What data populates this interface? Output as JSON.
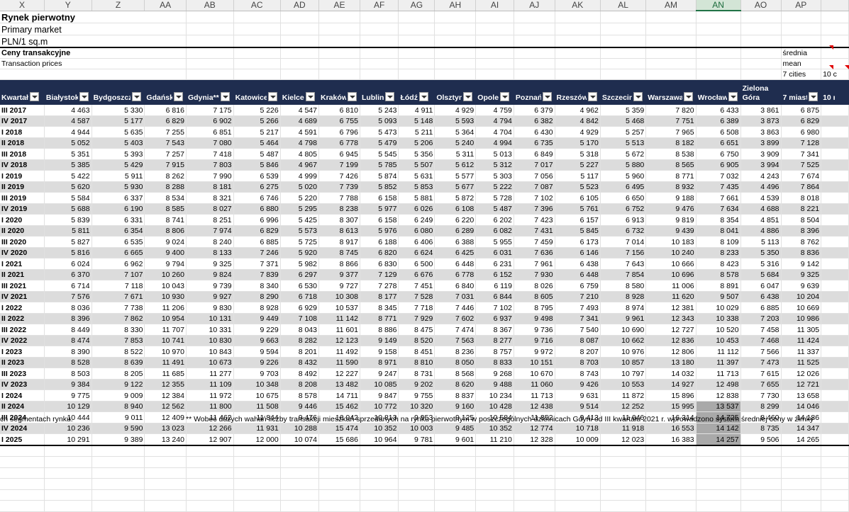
{
  "columns": [
    "X",
    "Y",
    "Z",
    "AA",
    "AB",
    "AC",
    "AD",
    "AE",
    "AF",
    "AG",
    "AH",
    "AI",
    "AJ",
    "AK",
    "AL",
    "AM",
    "AN",
    "AO",
    "AP"
  ],
  "title": {
    "line1": "Rynek pierwotny",
    "line2": "Primary market",
    "line3": "PLN/1 sq.m"
  },
  "section": {
    "line1": "Ceny transakcyjne",
    "line2": "Transaction prices"
  },
  "side": {
    "mean_pl": "średnia",
    "mean_en": "mean",
    "cities7": "7 cities",
    "cities10": "10 c"
  },
  "headers": [
    "Kwartał",
    "Białystok",
    "Bydgoszcz",
    "Gdańsk",
    "Gdynia**",
    "Katowice",
    "Kielce",
    "Kraków",
    "Lublin",
    "Łódź",
    "Olsztyn",
    "Opole",
    "Poznań",
    "Rzeszów",
    "Szczecin",
    "Warszawa",
    "Wrocław",
    "Zielona Góra",
    "7 miast",
    "10 m"
  ],
  "rows": [
    {
      "q": "III 2017",
      "v": [
        "4 463",
        "5 330",
        "6 816",
        "7 175",
        "5 226",
        "4 547",
        "6 810",
        "5 243",
        "4 911",
        "4 929",
        "4 759",
        "6 379",
        "4 962",
        "5 359",
        "7 820",
        "6 433",
        "3 861",
        "6 875"
      ]
    },
    {
      "q": "IV 2017",
      "v": [
        "4 587",
        "5 177",
        "6 829",
        "6 902",
        "5 266",
        "4 689",
        "6 755",
        "5 093",
        "5 148",
        "5 593",
        "4 794",
        "6 382",
        "4 842",
        "5 468",
        "7 751",
        "6 389",
        "3 873",
        "6 829"
      ]
    },
    {
      "q": "I 2018",
      "v": [
        "4 944",
        "5 635",
        "7 255",
        "6 851",
        "5 217",
        "4 591",
        "6 796",
        "5 473",
        "5 211",
        "5 364",
        "4 704",
        "6 430",
        "4 929",
        "5 257",
        "7 965",
        "6 508",
        "3 863",
        "6 980"
      ]
    },
    {
      "q": "II 2018",
      "v": [
        "5 052",
        "5 403",
        "7 543",
        "7 080",
        "5 464",
        "4 798",
        "6 778",
        "5 479",
        "5 206",
        "5 240",
        "4 994",
        "6 735",
        "5 170",
        "5 513",
        "8 182",
        "6 651",
        "3 899",
        "7 128"
      ]
    },
    {
      "q": "III 2018",
      "v": [
        "5 351",
        "5 393",
        "7 257",
        "7 418",
        "5 487",
        "4 805",
        "6 945",
        "5 545",
        "5 356",
        "5 311",
        "5 013",
        "6 849",
        "5 318",
        "5 672",
        "8 538",
        "6 750",
        "3 909",
        "7 341"
      ]
    },
    {
      "q": "IV 2018",
      "v": [
        "5 385",
        "5 429",
        "7 915",
        "7 803",
        "5 846",
        "4 967",
        "7 199",
        "5 785",
        "5 507",
        "5 612",
        "5 312",
        "7 017",
        "5 227",
        "5 880",
        "8 565",
        "6 905",
        "3 994",
        "7 525"
      ]
    },
    {
      "q": "I 2019",
      "v": [
        "5 422",
        "5 911",
        "8 262",
        "7 990",
        "6 539",
        "4 999",
        "7 426",
        "5 874",
        "5 631",
        "5 577",
        "5 303",
        "7 056",
        "5 117",
        "5 960",
        "8 771",
        "7 032",
        "4 243",
        "7 674"
      ]
    },
    {
      "q": "II 2019",
      "v": [
        "5 620",
        "5 930",
        "8 288",
        "8 181",
        "6 275",
        "5 020",
        "7 739",
        "5 852",
        "5 853",
        "5 677",
        "5 222",
        "7 087",
        "5 523",
        "6 495",
        "8 932",
        "7 435",
        "4 496",
        "7 864"
      ]
    },
    {
      "q": "III 2019",
      "v": [
        "5 584",
        "6 337",
        "8 534",
        "8 321",
        "6 746",
        "5 220",
        "7 788",
        "6 158",
        "5 881",
        "5 872",
        "5 728",
        "7 102",
        "6 105",
        "6 650",
        "9 188",
        "7 661",
        "4 539",
        "8 018"
      ]
    },
    {
      "q": "IV 2019",
      "v": [
        "5 688",
        "6 190",
        "8 585",
        "8 027",
        "6 880",
        "5 295",
        "8 238",
        "5 977",
        "6 026",
        "6 108",
        "5 487",
        "7 396",
        "5 761",
        "6 752",
        "9 476",
        "7 634",
        "4 688",
        "8 221"
      ]
    },
    {
      "q": "I 2020",
      "v": [
        "5 839",
        "6 331",
        "8 741",
        "8 251",
        "6 996",
        "5 425",
        "8 307",
        "6 158",
        "6 249",
        "6 220",
        "6 202",
        "7 423",
        "6 157",
        "6 913",
        "9 819",
        "8 354",
        "4 851",
        "8 504"
      ]
    },
    {
      "q": "II 2020",
      "v": [
        "5 811",
        "6 354",
        "8 806",
        "7 974",
        "6 829",
        "5 573",
        "8 613",
        "5 976",
        "6 080",
        "6 289",
        "6 082",
        "7 431",
        "5 845",
        "6 732",
        "9 439",
        "8 041",
        "4 886",
        "8 396"
      ]
    },
    {
      "q": "III 2020",
      "v": [
        "5 827",
        "6 535",
        "9 024",
        "8 240",
        "6 885",
        "5 725",
        "8 917",
        "6 188",
        "6 406",
        "6 388",
        "5 955",
        "7 459",
        "6 173",
        "7 014",
        "10 183",
        "8 109",
        "5 113",
        "8 762"
      ]
    },
    {
      "q": "IV 2020",
      "v": [
        "5 816",
        "6 665",
        "9 400",
        "8 133",
        "7 246",
        "5 920",
        "8 745",
        "6 820",
        "6 624",
        "6 425",
        "6 031",
        "7 636",
        "6 146",
        "7 156",
        "10 240",
        "8 233",
        "5 350",
        "8 836"
      ]
    },
    {
      "q": "I 2021",
      "v": [
        "6 024",
        "6 962",
        "9 794",
        "9 325",
        "7 371",
        "5 982",
        "8 866",
        "6 830",
        "6 500",
        "6 448",
        "6 231",
        "7 961",
        "6 438",
        "7 643",
        "10 666",
        "8 423",
        "5 316",
        "9 142"
      ]
    },
    {
      "q": "II 2021",
      "v": [
        "6 370",
        "7 107",
        "10 260",
        "9 824",
        "7 839",
        "6 297",
        "9 377",
        "7 129",
        "6 676",
        "6 778",
        "6 152",
        "7 930",
        "6 448",
        "7 854",
        "10 696",
        "8 578",
        "5 684",
        "9 325"
      ]
    },
    {
      "q": "III 2021",
      "v": [
        "6 714",
        "7 118",
        "10 043",
        "9 739",
        "8 340",
        "6 530",
        "9 727",
        "7 278",
        "7 451",
        "6 840",
        "6 119",
        "8 026",
        "6 759",
        "8 580",
        "11 006",
        "8 891",
        "6 047",
        "9 639"
      ]
    },
    {
      "q": "IV 2021",
      "v": [
        "7 576",
        "7 671",
        "10 930",
        "9 927",
        "8 290",
        "6 718",
        "10 308",
        "8 177",
        "7 528",
        "7 031",
        "6 844",
        "8 605",
        "7 210",
        "8 928",
        "11 620",
        "9 507",
        "6 438",
        "10 204"
      ]
    },
    {
      "q": "I 2022",
      "v": [
        "8 036",
        "7 738",
        "11 206",
        "9 830",
        "8 928",
        "6 929",
        "10 537",
        "8 345",
        "7 718",
        "7 446",
        "7 102",
        "8 795",
        "7 493",
        "8 974",
        "12 381",
        "10 029",
        "6 885",
        "10 669"
      ]
    },
    {
      "q": "II 2022",
      "v": [
        "8 396",
        "7 862",
        "10 954",
        "10 131",
        "9 449",
        "7 108",
        "11 142",
        "8 771",
        "7 929",
        "7 602",
        "6 937",
        "9 498",
        "7 341",
        "9 961",
        "12 343",
        "10 338",
        "7 203",
        "10 986"
      ]
    },
    {
      "q": "III 2022",
      "v": [
        "8 449",
        "8 330",
        "11 707",
        "10 331",
        "9 229",
        "8 043",
        "11 601",
        "8 886",
        "8 475",
        "7 474",
        "8 367",
        "9 736",
        "7 540",
        "10 690",
        "12 727",
        "10 520",
        "7 458",
        "11 305"
      ]
    },
    {
      "q": "IV 2022",
      "v": [
        "8 474",
        "7 853",
        "10 741",
        "10 830",
        "9 663",
        "8 282",
        "12 123",
        "9 149",
        "8 520",
        "7 563",
        "8 277",
        "9 716",
        "8 087",
        "10 662",
        "12 836",
        "10 453",
        "7 468",
        "11 424"
      ]
    },
    {
      "q": "I 2023",
      "v": [
        "8 390",
        "8 522",
        "10 970",
        "10 843",
        "9 594",
        "8 201",
        "11 492",
        "9 158",
        "8 451",
        "8 236",
        "8 757",
        "9 972",
        "8 207",
        "10 976",
        "12 806",
        "11 112",
        "7 566",
        "11 337"
      ]
    },
    {
      "q": "II 2023",
      "v": [
        "8 528",
        "8 639",
        "11 491",
        "10 673",
        "9 226",
        "8 432",
        "11 590",
        "8 971",
        "8 810",
        "8 050",
        "8 833",
        "10 151",
        "8 703",
        "10 857",
        "13 180",
        "11 397",
        "7 473",
        "11 525"
      ]
    },
    {
      "q": "III 2023",
      "v": [
        "8 503",
        "8 205",
        "11 685",
        "11 277",
        "9 703",
        "8 492",
        "12 227",
        "9 247",
        "8 731",
        "8 568",
        "9 268",
        "10 670",
        "8 743",
        "10 797",
        "14 032",
        "11 713",
        "7 615",
        "12 026"
      ]
    },
    {
      "q": "IV 2023",
      "v": [
        "9 384",
        "9 122",
        "12 355",
        "11 109",
        "10 348",
        "8 208",
        "13 482",
        "10 085",
        "9 202",
        "8 620",
        "9 488",
        "11 060",
        "9 426",
        "10 553",
        "14 927",
        "12 498",
        "7 655",
        "12 721"
      ]
    },
    {
      "q": "I 2024",
      "v": [
        "9 775",
        "9 009",
        "12 384",
        "11 972",
        "10 675",
        "8 578",
        "14 711",
        "9 847",
        "9 755",
        "8 837",
        "10 234",
        "11 713",
        "9 631",
        "11 872",
        "15 896",
        "12 838",
        "7 730",
        "13 658"
      ]
    },
    {
      "q": "II 2024",
      "v": [
        "10 129",
        "8 940",
        "12 562",
        "11 800",
        "11 508",
        "9 446",
        "15 462",
        "10 772",
        "10 320",
        "9 160",
        "10 428",
        "12 438",
        "9 514",
        "12 252",
        "15 995",
        "13 537",
        "8 299",
        "14 046"
      ]
    },
    {
      "q": "III 2024",
      "v": [
        "10 444",
        "9 011",
        "12 409",
        "11 462",
        "11 844",
        "9 476",
        "16 042",
        "10 813",
        "9 953",
        "9 125",
        "10 584",
        "11 852",
        "9 413",
        "11 646",
        "16 314",
        "14 725",
        "8 460",
        "14 186"
      ]
    },
    {
      "q": "IV 2024",
      "v": [
        "10 236",
        "9 590",
        "13 023",
        "12 266",
        "11 931",
        "10 288",
        "15 474",
        "10 352",
        "10 003",
        "9 485",
        "10 352",
        "12 774",
        "10 718",
        "11 918",
        "16 553",
        "14 142",
        "8 735",
        "14 347"
      ]
    },
    {
      "q": "I 2025",
      "v": [
        "10 291",
        "9 389",
        "13 240",
        "12 907",
        "12 000",
        "10 074",
        "15 686",
        "10 964",
        "9 781",
        "9 601",
        "11 210",
        "12 328",
        "10 009",
        "12 023",
        "16 383",
        "14 257",
        "9 506",
        "14 265"
      ]
    }
  ],
  "footnote_left": "ch segmentach rynku.",
  "footnote_right": "** Wobec dużych wahań liczby transakcji mieszkań sprzedanych na rynku pierwotnym w poszczególnych dzielnicach Gdyni od III kwartału 2021 r. wprowadzono system średniej ceny w źłmky"
}
